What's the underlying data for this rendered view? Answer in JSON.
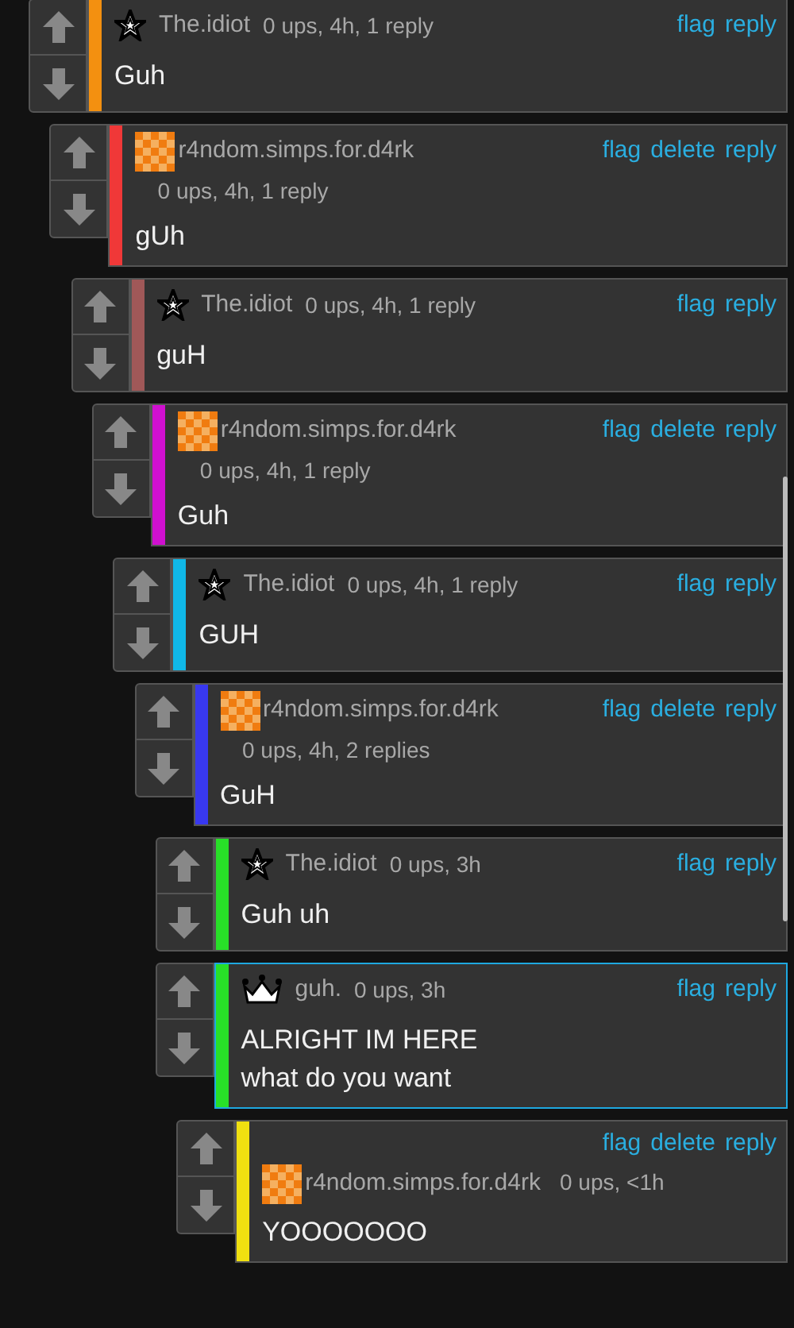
{
  "comments": [
    {
      "avatar": {
        "kind": "star"
      },
      "user": "The.idiot",
      "meta": "0 ups, 4h, 1 reply",
      "actions": [
        "flag",
        "reply"
      ],
      "body": [
        "Guh"
      ],
      "color": "#f39010",
      "kind": "inline",
      "highlighted": false,
      "children": [
        {
          "avatar": {
            "kind": "checker"
          },
          "user": "r4ndom.simps.for.d4rk",
          "meta": "0 ups, 4h, 1 reply",
          "actions": [
            "flag",
            "delete",
            "reply"
          ],
          "body": [
            "gUh"
          ],
          "color": "#f03838",
          "kind": "wrapped",
          "highlighted": false,
          "children": [
            {
              "avatar": {
                "kind": "star"
              },
              "user": "The.idiot",
              "meta": "0 ups, 4h, 1 reply",
              "actions": [
                "flag",
                "reply"
              ],
              "body": [
                "guH"
              ],
              "color": "#a05858",
              "kind": "inline",
              "highlighted": false,
              "children": [
                {
                  "avatar": {
                    "kind": "checker"
                  },
                  "user": "r4ndom.simps.for.d4rk",
                  "meta": "0 ups, 4h, 1 reply",
                  "actions": [
                    "flag",
                    "delete",
                    "reply"
                  ],
                  "body": [
                    "Guh"
                  ],
                  "color": "#d010d0",
                  "kind": "wrapped",
                  "highlighted": false,
                  "children": [
                    {
                      "avatar": {
                        "kind": "star"
                      },
                      "user": "The.idiot",
                      "meta": "0 ups, 4h, 1 reply",
                      "actions": [
                        "flag",
                        "reply"
                      ],
                      "body": [
                        "GUH"
                      ],
                      "color": "#10b8e8",
                      "kind": "inline",
                      "highlighted": false,
                      "children": [
                        {
                          "avatar": {
                            "kind": "checker"
                          },
                          "user": "r4ndom.simps.for.d4rk",
                          "meta": "0 ups, 4h, 2 replies",
                          "actions": [
                            "flag",
                            "delete",
                            "reply"
                          ],
                          "body": [
                            "GuH"
                          ],
                          "color": "#3838f0",
                          "kind": "wrapped",
                          "highlighted": false,
                          "children": [
                            {
                              "avatar": {
                                "kind": "star"
                              },
                              "user": "The.idiot",
                              "meta": "0 ups, 3h",
                              "actions": [
                                "flag",
                                "reply"
                              ],
                              "body": [
                                "Guh uh"
                              ],
                              "color": "#28e028",
                              "kind": "inline",
                              "highlighted": false
                            },
                            {
                              "avatar": {
                                "kind": "crown"
                              },
                              "user": "guh.",
                              "meta": "0 ups, 3h",
                              "actions": [
                                "flag",
                                "reply"
                              ],
                              "body": [
                                "ALRIGHT IM HERE",
                                "what do you want"
                              ],
                              "color": "#28e028",
                              "kind": "inline",
                              "highlighted": true,
                              "children": [
                                {
                                  "avatar": {
                                    "kind": "checker"
                                  },
                                  "user": "r4ndom.simps.for.d4rk",
                                  "meta": "0 ups, <1h",
                                  "actions": [
                                    "flag",
                                    "delete",
                                    "reply"
                                  ],
                                  "body": [
                                    "YOOOOOOO"
                                  ],
                                  "color": "#f0e010",
                                  "kind": "actions-first",
                                  "highlighted": false
                                }
                              ]
                            }
                          ]
                        }
                      ]
                    }
                  ]
                }
              ]
            }
          ]
        }
      ]
    }
  ]
}
